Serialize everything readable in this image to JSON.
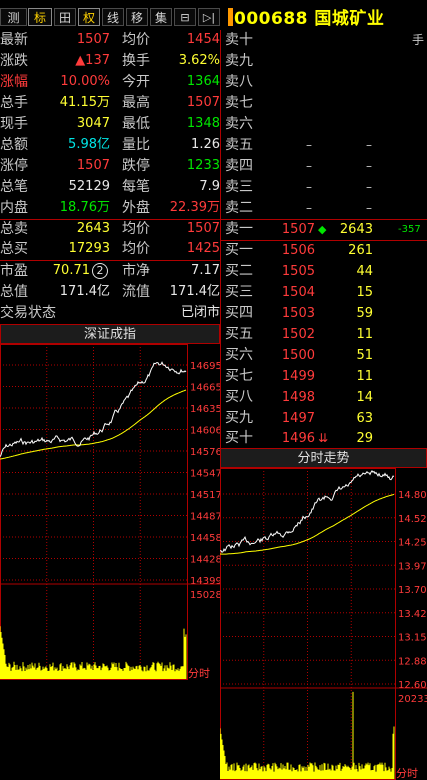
{
  "toolbar": {
    "buttons": [
      {
        "label": "测",
        "active": false
      },
      {
        "label": "标",
        "active": true
      },
      {
        "label": "田",
        "active": false
      },
      {
        "label": "权",
        "active": false
      },
      {
        "label": "线",
        "active": false
      },
      {
        "label": "移",
        "active": false
      },
      {
        "label": "集",
        "active": false
      },
      {
        "label": "⊟",
        "active": false
      },
      {
        "label": "▷|",
        "active": false
      }
    ]
  },
  "stock": {
    "code": "000688",
    "name": "国城矿业"
  },
  "quote": {
    "latest_label": "最新",
    "latest": "1507",
    "avg_label": "均价",
    "avg": "1454",
    "change_label": "涨跌",
    "change": "▲137",
    "turnover_label": "换手",
    "turnover": "3.62%",
    "pct_label": "涨幅",
    "pct": "10.00%",
    "open_label": "今开",
    "open": "1364",
    "total_hands_label": "总手",
    "total_hands": "41.15万",
    "high_label": "最高",
    "high": "1507",
    "current_hands_label": "现手",
    "current_hands": "3047",
    "low_label": "最低",
    "low": "1348",
    "amount_label": "总额",
    "amount": "5.98亿",
    "vol_ratio_label": "量比",
    "vol_ratio": "1.26",
    "limit_up_label": "涨停",
    "limit_up": "1507",
    "limit_down_label": "跌停",
    "limit_down": "1233",
    "trades_label": "总笔",
    "trades": "52129",
    "per_trade_label": "每笔",
    "per_trade": "7.9",
    "inner_label": "内盘",
    "inner": "18.76万",
    "outer_label": "外盘",
    "outer": "22.39万",
    "total_sell_label": "总卖",
    "total_sell": "2643",
    "sell_avg_label": "均价",
    "sell_avg": "1507",
    "total_buy_label": "总买",
    "total_buy": "17293",
    "buy_avg_label": "均价",
    "buy_avg": "1425",
    "pe_label": "市盈",
    "pe": "70.71",
    "pe_badge": "2",
    "pb_label": "市净",
    "pb": "7.17",
    "mktcap_label": "总值",
    "mktcap": "171.4亿",
    "float_label": "流值",
    "float": "171.4亿",
    "status_label": "交易状态",
    "status": "已闭市"
  },
  "orderbook": {
    "unit_label": "手",
    "asks": [
      {
        "label": "卖十",
        "price": "",
        "volume": ""
      },
      {
        "label": "卖九",
        "price": "",
        "volume": ""
      },
      {
        "label": "卖八",
        "price": "",
        "volume": ""
      },
      {
        "label": "卖七",
        "price": "",
        "volume": ""
      },
      {
        "label": "卖六",
        "price": "",
        "volume": ""
      },
      {
        "label": "卖五",
        "price": "–",
        "volume": "–"
      },
      {
        "label": "卖四",
        "price": "–",
        "volume": "–"
      },
      {
        "label": "卖三",
        "price": "–",
        "volume": "–"
      },
      {
        "label": "卖二",
        "price": "–",
        "volume": "–"
      },
      {
        "label": "卖一",
        "price": "1507",
        "volume": "2643",
        "extra": "-357"
      }
    ],
    "bids": [
      {
        "label": "买一",
        "price": "1506",
        "volume": "261"
      },
      {
        "label": "买二",
        "price": "1505",
        "volume": "44"
      },
      {
        "label": "买三",
        "price": "1504",
        "volume": "15"
      },
      {
        "label": "买四",
        "price": "1503",
        "volume": "59"
      },
      {
        "label": "买五",
        "price": "1502",
        "volume": "11"
      },
      {
        "label": "买六",
        "price": "1500",
        "volume": "51"
      },
      {
        "label": "买七",
        "price": "1499",
        "volume": "11"
      },
      {
        "label": "买八",
        "price": "1498",
        "volume": "14"
      },
      {
        "label": "买九",
        "price": "1497",
        "volume": "63"
      },
      {
        "label": "买十",
        "price": "1496",
        "volume": "29"
      }
    ]
  },
  "index_chart": {
    "title": "深证成指",
    "y_ticks": [
      "14695",
      "14665",
      "14635",
      "14606",
      "14576",
      "14547",
      "14517",
      "14487",
      "14458",
      "14428",
      "14399"
    ],
    "volume_max": "15028",
    "time_label": "分时"
  },
  "stock_chart": {
    "title": "分时走势",
    "y_ticks": [
      "14.80",
      "14.52",
      "14.25",
      "13.97",
      "13.70",
      "13.42",
      "13.15",
      "12.88",
      "12.60"
    ],
    "volume_max": "20233",
    "time_label": "分时"
  },
  "colors": {
    "price_line": "#ffffff",
    "avg_line": "#ffff00",
    "volume_bar": "#ffff00",
    "grid": "#b00000",
    "up": "#ff3b3b",
    "down": "#00e600"
  }
}
